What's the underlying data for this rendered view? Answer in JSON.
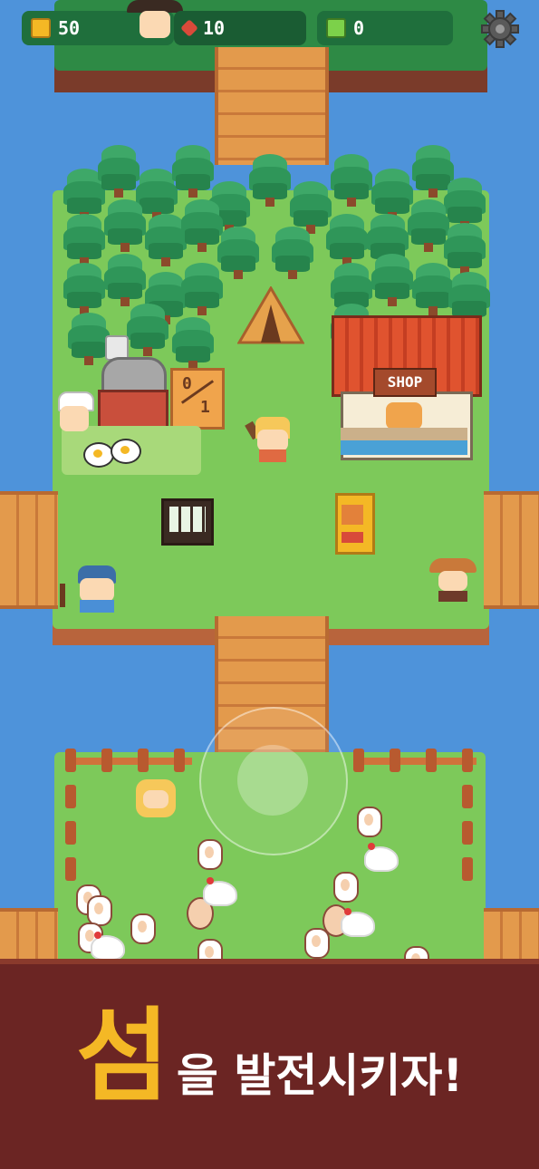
{
  "hud": {
    "coins": "50",
    "gems_red": "10",
    "gems_green": "0",
    "settings_icon": "gear-icon"
  },
  "shop": {
    "sign": "SHOP"
  },
  "board": {
    "counter_top": "0",
    "counter_bottom": "1"
  },
  "banner": {
    "highlight": "섬",
    "rest": "을 발전시키자!"
  },
  "colors": {
    "water": "#4e93da",
    "grass": "#7dc95a",
    "banner": "#6b2523",
    "highlight": "#f4b825"
  }
}
